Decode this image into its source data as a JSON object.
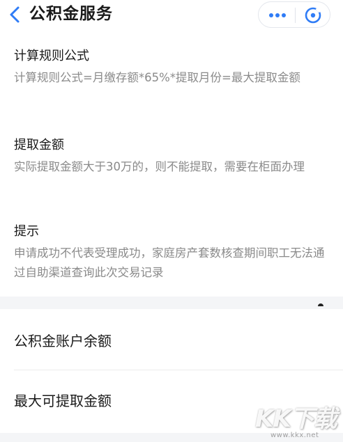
{
  "header": {
    "title": "公积金服务",
    "back_icon": "chevron-left-icon",
    "more_icon": "more-dots-icon",
    "close_icon": "close-target-icon"
  },
  "colors": {
    "accent": "#2f7cf6",
    "text_primary": "#1a1a1a",
    "text_secondary": "#8a8a8a",
    "divider": "#ececec"
  },
  "sections": [
    {
      "title": "计算规则公式",
      "text": "计算规则公式=月缴存额*65%*提取月份=最大提取金额"
    },
    {
      "title": "提取金额",
      "text": "实际提取金额大于30万的，则不能提取，需要在柜面办理"
    },
    {
      "title": "提示",
      "text": "申请成功不代表受理成功，家庭房产套数核查期间职工无法通过自助渠道查询此次交易记录"
    }
  ],
  "list": [
    {
      "label": "公积金账户余额"
    },
    {
      "label": "最大可提取金额"
    }
  ],
  "watermark": {
    "logo": "KK下载",
    "url": "www.kkx.net"
  }
}
